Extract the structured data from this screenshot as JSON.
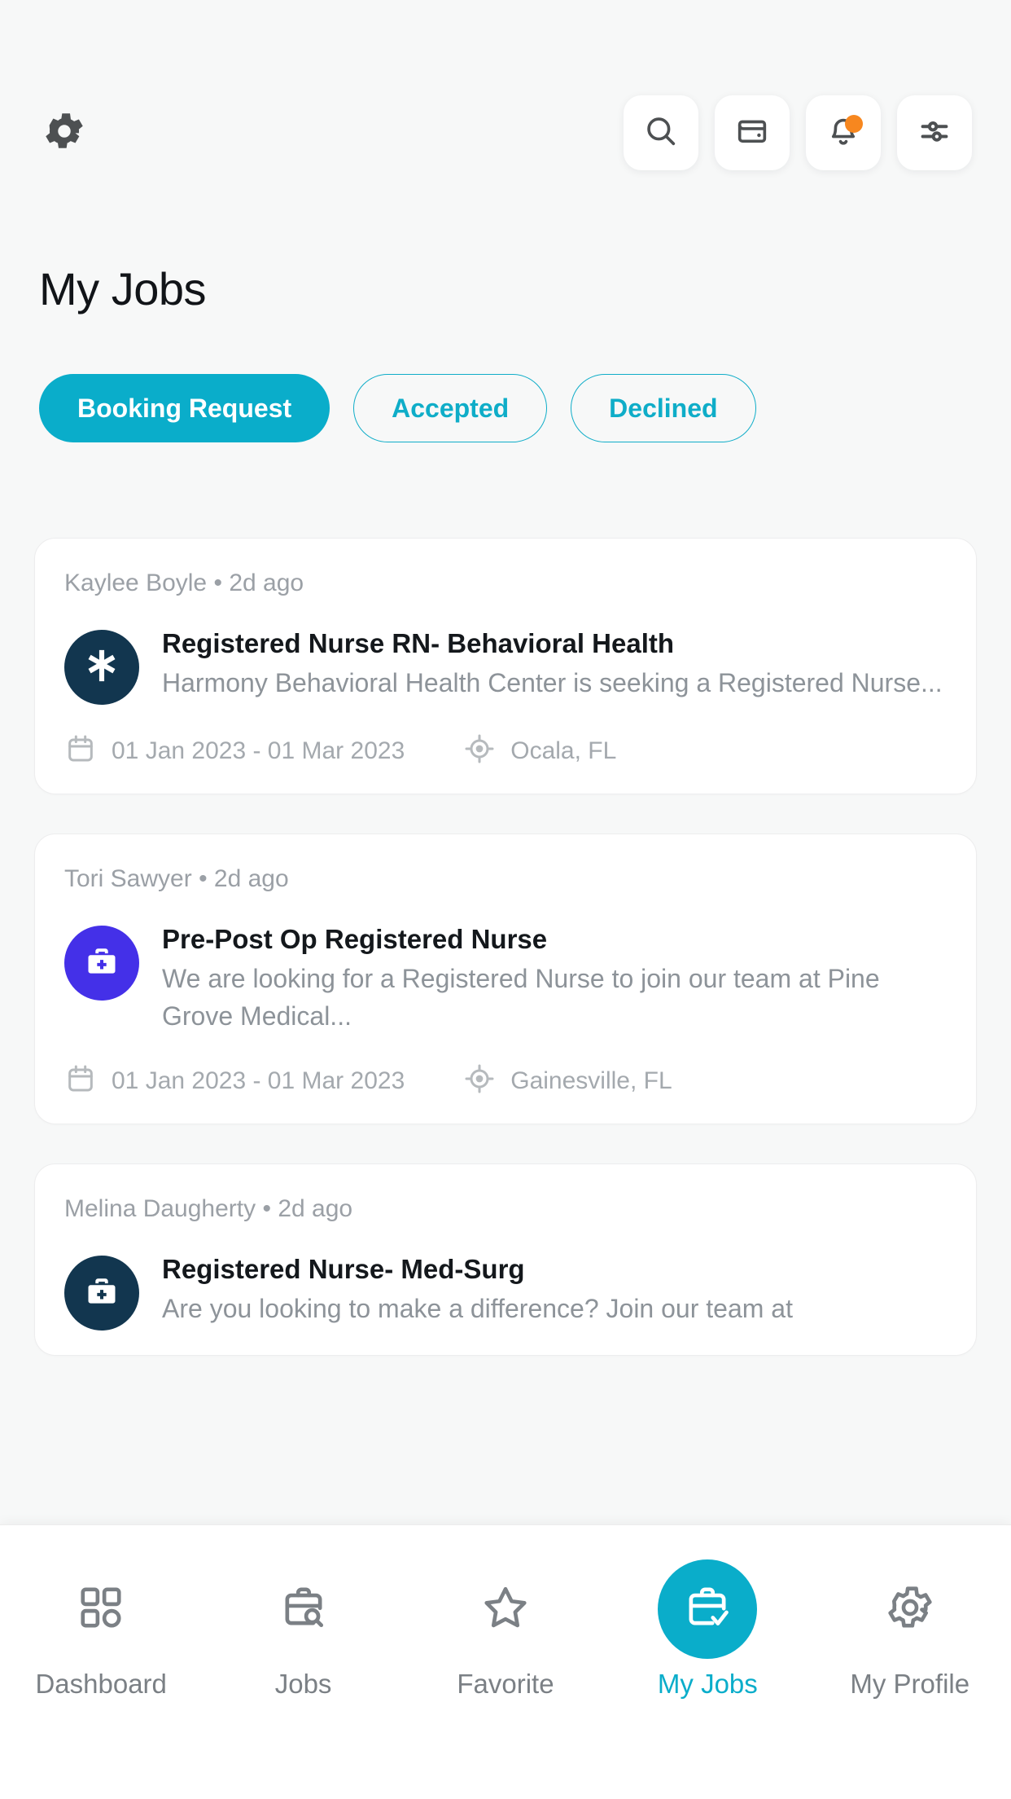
{
  "header": {
    "settings_icon": "gear-icon",
    "actions": [
      {
        "name": "search-icon",
        "label": "Search"
      },
      {
        "name": "wallet-icon",
        "label": "Wallet"
      },
      {
        "name": "bell-icon",
        "label": "Notifications",
        "badge": true
      },
      {
        "name": "filter-icon",
        "label": "Filters"
      }
    ],
    "badge_color": "#f7871f"
  },
  "page": {
    "title": "My Jobs"
  },
  "tabs": {
    "accent": "#0aadca",
    "items": [
      {
        "label": "Booking Request",
        "active": true
      },
      {
        "label": "Accepted",
        "active": false
      },
      {
        "label": "Declined",
        "active": false
      }
    ]
  },
  "jobs": [
    {
      "poster": "Kaylee Boyle",
      "separator": "•",
      "posted": "2d ago",
      "title": "Registered Nurse RN- Behavioral Health",
      "description": "Harmony Behavioral Health Center is seeking a Registered Nurse...",
      "dates": "01 Jan 2023 - 01 Mar 2023",
      "location": "Ocala, FL",
      "avatar_color": "#12364f",
      "avatar_icon": "star-of-life-icon"
    },
    {
      "poster": "Tori Sawyer",
      "separator": "•",
      "posted": "2d ago",
      "title": "Pre-Post Op Registered Nurse",
      "description": "We are looking for a Registered Nurse to join our team at Pine Grove Medical...",
      "dates": "01 Jan 2023 - 01 Mar 2023",
      "location": "Gainesville, FL",
      "avatar_color": "#4430e8",
      "avatar_icon": "medical-bag-icon"
    },
    {
      "poster": "Melina Daugherty",
      "separator": "•",
      "posted": "2d ago",
      "title": "Registered Nurse- Med-Surg",
      "description": "Are you looking to make a difference? Join our team at",
      "dates": "",
      "location": "",
      "avatar_color": "#12364f",
      "avatar_icon": "medical-bag-icon"
    }
  ],
  "bottom_nav": {
    "active_color": "#0aadca",
    "items": [
      {
        "label": "Dashboard",
        "icon": "grid-icon",
        "active": false
      },
      {
        "label": "Jobs",
        "icon": "briefcase-search-icon",
        "active": false
      },
      {
        "label": "Favorite",
        "icon": "star-icon",
        "active": false
      },
      {
        "label": "My Jobs",
        "icon": "briefcase-check-icon",
        "active": true
      },
      {
        "label": "My Profile",
        "icon": "gear-icon",
        "active": false
      }
    ]
  }
}
